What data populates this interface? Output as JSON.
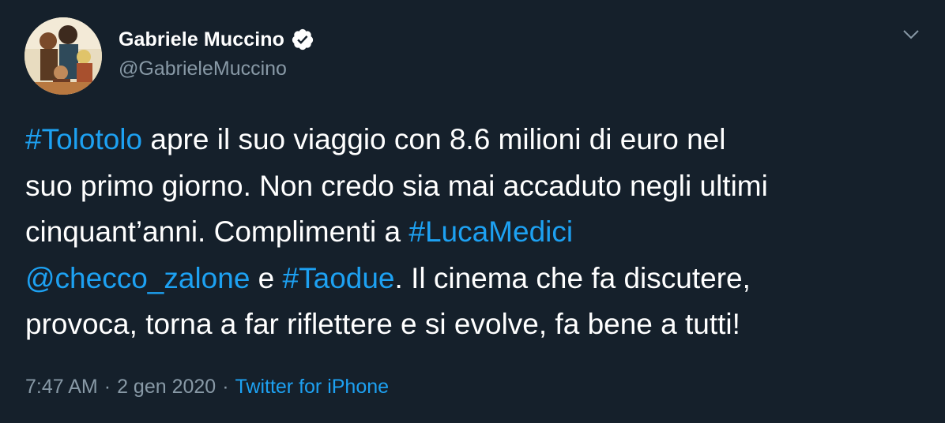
{
  "user": {
    "display_name": "Gabriele Muccino",
    "handle": "@GabrieleMuccino",
    "verified": true,
    "avatar_icon": "user-avatar"
  },
  "tweet": {
    "lines": [
      [
        {
          "text": "#Tolotolo",
          "link": true
        },
        {
          "text": " apre il suo viaggio con 8.6 milioni di euro nel",
          "link": false
        }
      ],
      [
        {
          "text": "suo primo giorno. Non credo sia mai accaduto negli ultimi",
          "link": false
        }
      ],
      [
        {
          "text": "cinquant’anni. Complimenti a ",
          "link": false
        },
        {
          "text": "#LucaMedici",
          "link": true
        }
      ],
      [
        {
          "text": "@checco_zalone",
          "link": true
        },
        {
          "text": " e ",
          "link": false
        },
        {
          "text": "#Taodue",
          "link": true
        },
        {
          "text": ". Il cinema che fa discutere,",
          "link": false
        }
      ],
      [
        {
          "text": "provoca, torna a far riflettere e si evolve, fa bene a tutti!",
          "link": false
        }
      ]
    ]
  },
  "meta": {
    "time": "7:47 AM",
    "separator": "·",
    "date": "2 gen 2020",
    "source": "Twitter for iPhone"
  },
  "colors": {
    "background": "#15202b",
    "text": "#ffffff",
    "secondary": "#8899a6",
    "accent": "#1da1f2"
  },
  "icons": {
    "verified": "verified-badge-icon",
    "more": "chevron-down-icon"
  }
}
